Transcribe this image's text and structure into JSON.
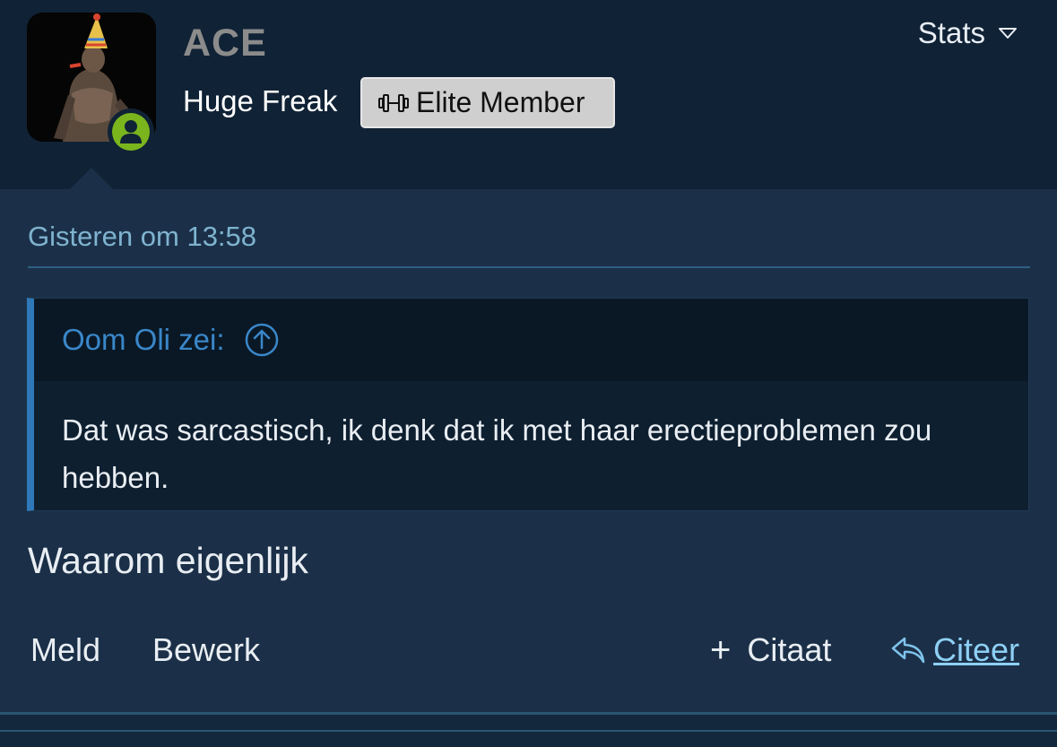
{
  "header": {
    "username": "ACE",
    "user_title": "Huge Freak",
    "badge_label": "Elite Member",
    "badge_icon": "dumbbell-icon",
    "stats_label": "Stats",
    "online_status_icon": "user-online-icon"
  },
  "post": {
    "timestamp": "Gisteren om 13:58",
    "quote": {
      "author": "Oom Oli zei:",
      "jump_icon": "arrow-up-circle-icon",
      "text": "Dat was sarcastisch, ik denk dat ik met haar erectieproblemen zou hebben."
    },
    "message": "Waarom eigenlijk"
  },
  "actions": {
    "report": "Meld",
    "edit": "Bewerk",
    "multi_quote": "Citaat",
    "multi_quote_icon": "plus-icon",
    "reply_quote": "Citeer",
    "reply_quote_icon": "reply-icon"
  },
  "colors": {
    "header_bg": "#102235",
    "body_bg": "#1b3048",
    "accent_blue": "#3a87c9",
    "online_green": "#7ab51d",
    "link": "#8ed0f5"
  }
}
